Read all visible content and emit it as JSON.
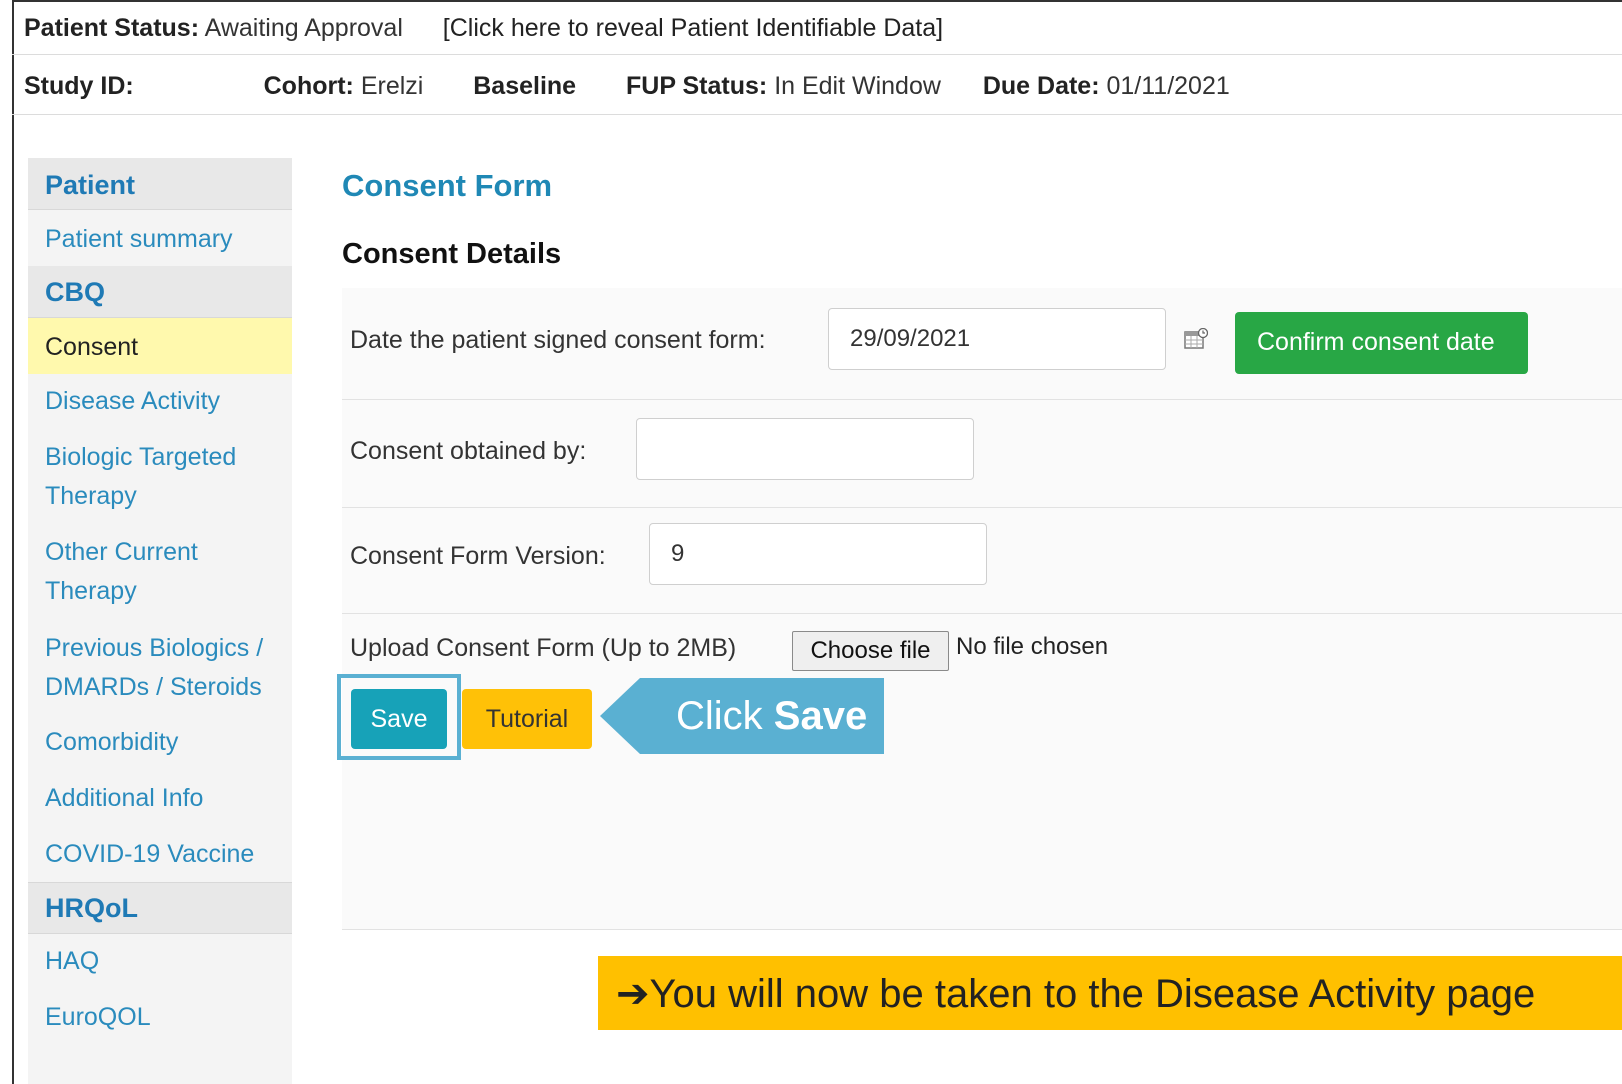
{
  "header": {
    "patient_status_label": "Patient Status:",
    "patient_status_value": "Awaiting Approval",
    "reveal_link": "[Click here to reveal Patient Identifiable Data]",
    "study_id_label": "Study ID:",
    "cohort_label": "Cohort:",
    "cohort_value": "Erelzi",
    "visit": "Baseline",
    "fup_status_label": "FUP Status:",
    "fup_status_value": "In Edit Window",
    "due_date_label": "Due Date:",
    "due_date_value": "01/11/2021"
  },
  "sidebar": {
    "sections": [
      {
        "heading": "Patient",
        "items": [
          "Patient summary"
        ]
      },
      {
        "heading": "CBQ",
        "items": [
          "Consent",
          "Disease Activity",
          "Biologic Targeted Therapy",
          "Other Current Therapy",
          "Previous Biologics / DMARDs / Steroids",
          "Comorbidity",
          "Additional Info",
          "COVID-19 Vaccine"
        ]
      },
      {
        "heading": "HRQoL",
        "items": [
          "HAQ",
          "EuroQOL"
        ]
      }
    ],
    "active_item": "Consent",
    "labels": {
      "patient_heading": "Patient",
      "patient_summary": "Patient summary",
      "cbq_heading": "CBQ",
      "consent": "Consent",
      "disease_activity": "Disease Activity",
      "biologic_1": "Biologic Targeted",
      "biologic_2": "Therapy",
      "other_1": "Other Current",
      "other_2": "Therapy",
      "previous_1": "Previous Biologics /",
      "previous_2": "DMARDs / Steroids",
      "comorbidity": "Comorbidity",
      "additional_info": "Additional Info",
      "covid": "COVID-19 Vaccine",
      "hrqol_heading": "HRQoL",
      "haq": "HAQ",
      "euroqol": "EuroQOL"
    }
  },
  "form": {
    "title": "Consent Form",
    "section_title": "Consent Details",
    "date_signed_label": "Date the patient signed consent form:",
    "date_signed_value": "29/09/2021",
    "confirm_button": "Confirm consent date",
    "obtained_by_label": "Consent obtained by:",
    "obtained_by_value": "",
    "version_label": "Consent Form Version:",
    "version_value": "9",
    "upload_label": "Upload Consent Form (Up to 2MB)",
    "choose_file_button": "Choose file",
    "file_status": "No file chosen",
    "save_button": "Save",
    "tutorial_button": "Tutorial"
  },
  "annotations": {
    "callout_prefix": "Click",
    "callout_bold": "Save",
    "notice_arrow": "➔",
    "notice_text": "You will now be taken to the Disease Activity page",
    "callout_color": "#5ab0d2",
    "notice_color": "#ffc000"
  },
  "icons": {
    "calendar": "calendar-icon"
  }
}
